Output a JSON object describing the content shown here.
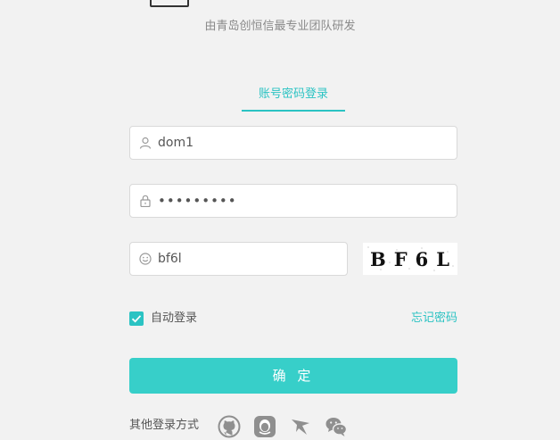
{
  "header": {
    "title": "",
    "subtitle": "由青岛创恒信最专业团队研发"
  },
  "tabs": [
    {
      "label": "账号密码登录",
      "active": true
    }
  ],
  "form": {
    "username": {
      "value": "dom1",
      "icon": "user-icon"
    },
    "password": {
      "value": "•••••••••",
      "icon": "lock-icon"
    },
    "captcha": {
      "value": "bf6l",
      "icon": "smile-icon",
      "image_text": "BF6L"
    },
    "remember_label": "自动登录",
    "remember_checked": true,
    "forgot_label": "忘记密码",
    "submit_label": "确 定"
  },
  "other_login": {
    "label": "其他登录方式",
    "providers": [
      "github-icon",
      "qq-icon",
      "weibo-icon",
      "wechat-icon"
    ]
  },
  "colors": {
    "accent": "#2bc3c3",
    "button": "#37cfc9",
    "background": "#f2f2f2",
    "icon_gray": "#9a9a9a"
  }
}
